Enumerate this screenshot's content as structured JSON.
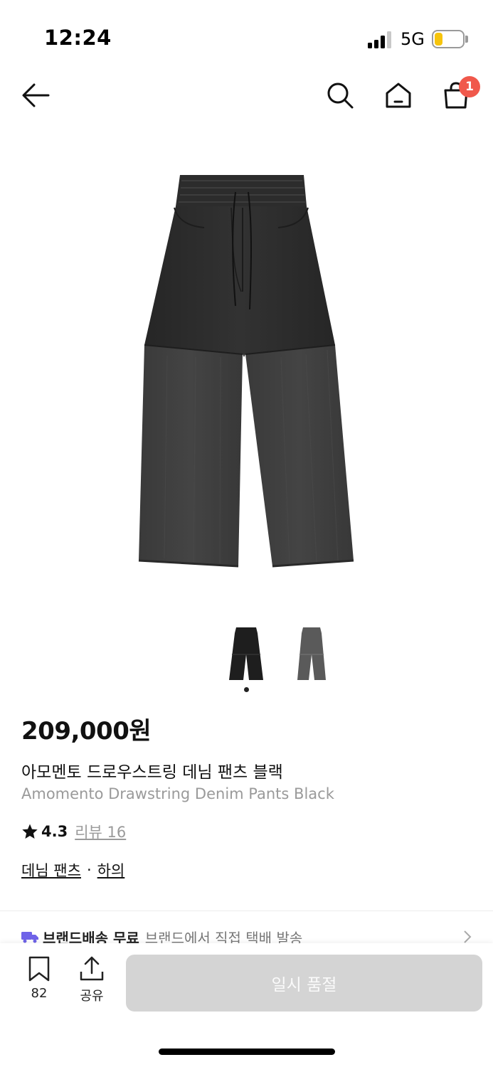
{
  "status_bar": {
    "time": "12:24",
    "network": "5G",
    "battery_level": 0.3,
    "battery_color": "#f6c40c"
  },
  "header": {
    "back_icon": "arrow-left-icon",
    "search_icon": "search-icon",
    "home_icon": "home-icon",
    "cart_icon": "shopping-bag-icon",
    "cart_count": "1",
    "badge_color": "#f0584b"
  },
  "gallery": {
    "image_count": 2,
    "active_index": 0
  },
  "product": {
    "price": "209,000원",
    "name_ko": "아모멘토 드로우스트링 데님 팬츠 블랙",
    "name_en": "Amomento Drawstring Denim Pants Black",
    "rating": "4.3",
    "review_label": "리뷰 16",
    "categories": [
      "데님 팬츠",
      "하의"
    ],
    "category_separator": "·"
  },
  "shipping": {
    "title": "브랜드배송 무료",
    "description": "브랜드에서 직접 택배 발송"
  },
  "bottom_bar": {
    "bookmark_count": "82",
    "share_label": "공유",
    "soldout_label": "일시 품절"
  }
}
